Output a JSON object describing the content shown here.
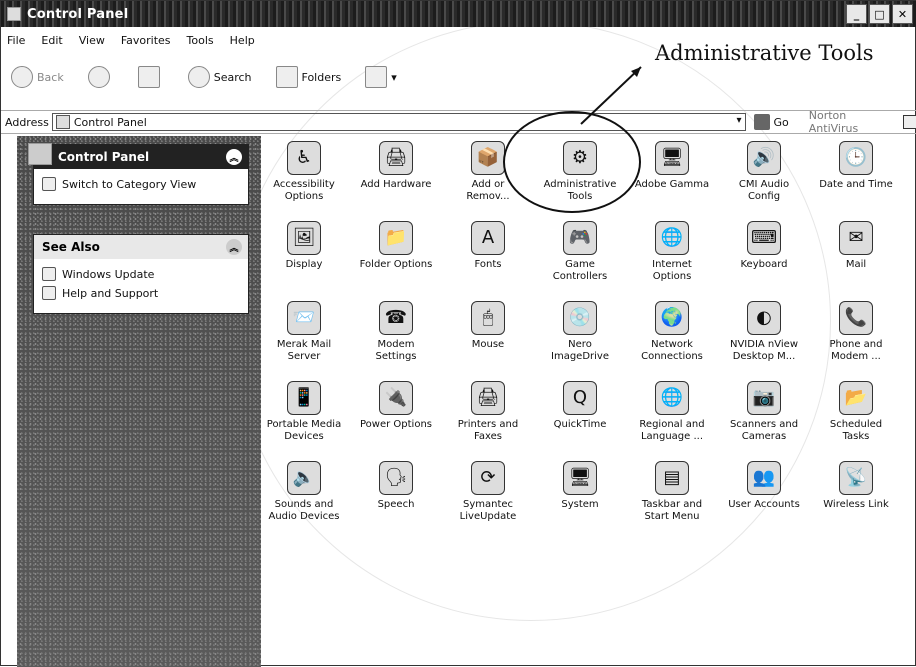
{
  "window": {
    "title": "Control Panel",
    "buttons": [
      "_",
      "□",
      "✕"
    ]
  },
  "menu": [
    "File",
    "Edit",
    "View",
    "Favorites",
    "Tools",
    "Help"
  ],
  "toolbar": {
    "back": "Back",
    "search": "Search",
    "folders": "Folders"
  },
  "address": {
    "label": "Address",
    "value": "Control Panel",
    "go": "Go",
    "norton": "Norton AntiVirus"
  },
  "left": {
    "cp_header": "Control Panel",
    "switch_view": "Switch to Category View",
    "see_also_header": "See Also",
    "links": [
      "Windows Update",
      "Help and Support"
    ]
  },
  "annotation": {
    "label": "Administrative Tools"
  },
  "icons": [
    {
      "name": "accessibility-options-icon",
      "label": "Accessibility Options",
      "glyph": "♿"
    },
    {
      "name": "add-hardware-icon",
      "label": "Add Hardware",
      "glyph": "🖨"
    },
    {
      "name": "add-remove-programs-icon",
      "label": "Add or Remov...",
      "glyph": "📦"
    },
    {
      "name": "administrative-tools-icon",
      "label": "Administrative Tools",
      "glyph": "⚙"
    },
    {
      "name": "adobe-gamma-icon",
      "label": "Adobe Gamma",
      "glyph": "🖥"
    },
    {
      "name": "cmi-audio-config-icon",
      "label": "CMI Audio Config",
      "glyph": "🔊"
    },
    {
      "name": "date-and-time-icon",
      "label": "Date and Time",
      "glyph": "🕒"
    },
    {
      "name": "display-icon",
      "label": "Display",
      "glyph": "🖼"
    },
    {
      "name": "folder-options-icon",
      "label": "Folder Options",
      "glyph": "📁"
    },
    {
      "name": "fonts-icon",
      "label": "Fonts",
      "glyph": "A"
    },
    {
      "name": "game-controllers-icon",
      "label": "Game Controllers",
      "glyph": "🎮"
    },
    {
      "name": "internet-options-icon",
      "label": "Internet Options",
      "glyph": "🌐"
    },
    {
      "name": "keyboard-icon",
      "label": "Keyboard",
      "glyph": "⌨"
    },
    {
      "name": "mail-icon",
      "label": "Mail",
      "glyph": "✉"
    },
    {
      "name": "merak-mail-server-icon",
      "label": "Merak Mail Server",
      "glyph": "📨"
    },
    {
      "name": "modem-settings-icon",
      "label": "Modem Settings",
      "glyph": "☎"
    },
    {
      "name": "mouse-icon",
      "label": "Mouse",
      "glyph": "🖱"
    },
    {
      "name": "nero-imagedrive-icon",
      "label": "Nero ImageDrive",
      "glyph": "💿"
    },
    {
      "name": "network-connections-icon",
      "label": "Network Connections",
      "glyph": "🌍"
    },
    {
      "name": "nvidia-nview-icon",
      "label": "NVIDIA nView Desktop M...",
      "glyph": "◐"
    },
    {
      "name": "phone-and-modem-icon",
      "label": "Phone and Modem ...",
      "glyph": "📞"
    },
    {
      "name": "portable-media-devices-icon",
      "label": "Portable Media Devices",
      "glyph": "📱"
    },
    {
      "name": "power-options-icon",
      "label": "Power Options",
      "glyph": "🔌"
    },
    {
      "name": "printers-and-faxes-icon",
      "label": "Printers and Faxes",
      "glyph": "🖨"
    },
    {
      "name": "quicktime-icon",
      "label": "QuickTime",
      "glyph": "Q"
    },
    {
      "name": "regional-and-language-icon",
      "label": "Regional and Language ...",
      "glyph": "🌐"
    },
    {
      "name": "scanners-and-cameras-icon",
      "label": "Scanners and Cameras",
      "glyph": "📷"
    },
    {
      "name": "scheduled-tasks-icon",
      "label": "Scheduled Tasks",
      "glyph": "📂"
    },
    {
      "name": "sounds-and-audio-icon",
      "label": "Sounds and Audio Devices",
      "glyph": "🔈"
    },
    {
      "name": "speech-icon",
      "label": "Speech",
      "glyph": "🗣"
    },
    {
      "name": "symantec-liveupdate-icon",
      "label": "Symantec LiveUpdate",
      "glyph": "⟳"
    },
    {
      "name": "system-icon",
      "label": "System",
      "glyph": "🖥"
    },
    {
      "name": "taskbar-start-menu-icon",
      "label": "Taskbar and Start Menu",
      "glyph": "▤"
    },
    {
      "name": "user-accounts-icon",
      "label": "User Accounts",
      "glyph": "👥"
    },
    {
      "name": "wireless-link-icon",
      "label": "Wireless Link",
      "glyph": "📡"
    }
  ]
}
